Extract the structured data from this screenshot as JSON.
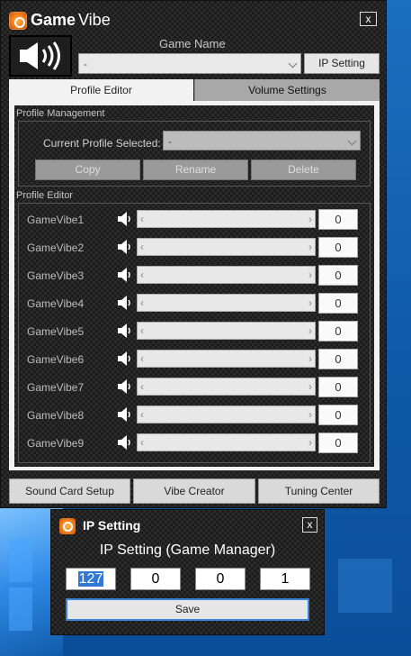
{
  "main_window": {
    "title_bold": "Game",
    "title_light": "Vibe",
    "close_glyph": "x",
    "game_name_label": "Game Name",
    "game_select_value": "-",
    "ip_setting_button": "IP Setting",
    "tabs": [
      {
        "label": "Profile Editor",
        "active": true
      },
      {
        "label": "Volume Settings",
        "active": false
      }
    ]
  },
  "profile_management": {
    "group_label": "Profile Management",
    "current_profile_label": "Current Profile Selected:",
    "current_profile_value": "-",
    "buttons": {
      "copy": "Copy",
      "rename": "Rename",
      "delete": "Delete"
    }
  },
  "profile_editor": {
    "group_label": "Profile Editor",
    "rows": [
      {
        "label": "GameVibe1",
        "value": "0"
      },
      {
        "label": "GameVibe2",
        "value": "0"
      },
      {
        "label": "GameVibe3",
        "value": "0"
      },
      {
        "label": "GameVibe4",
        "value": "0"
      },
      {
        "label": "GameVibe5",
        "value": "0"
      },
      {
        "label": "GameVibe6",
        "value": "0"
      },
      {
        "label": "GameVibe7",
        "value": "0"
      },
      {
        "label": "GameVibe8",
        "value": "0"
      },
      {
        "label": "GameVibe9",
        "value": "0"
      }
    ]
  },
  "bottom_buttons": {
    "sound_card_setup": "Sound Card Setup",
    "vibe_creator": "Vibe Creator",
    "tuning_center": "Tuning Center"
  },
  "ip_dialog": {
    "title": "IP Setting",
    "close_glyph": "x",
    "heading": "IP Setting (Game Manager)",
    "octets": [
      "127",
      "0",
      "0",
      "1"
    ],
    "save_button": "Save"
  },
  "icons": {
    "app_logo": "game-vibe-logo-icon",
    "speaker": "speaker-volume-icon"
  },
  "colors": {
    "window_bg": "#2b2b2b",
    "accent_logo": "#f07a1a",
    "selection": "#3178d4",
    "desktop": "#1b6fbf"
  }
}
